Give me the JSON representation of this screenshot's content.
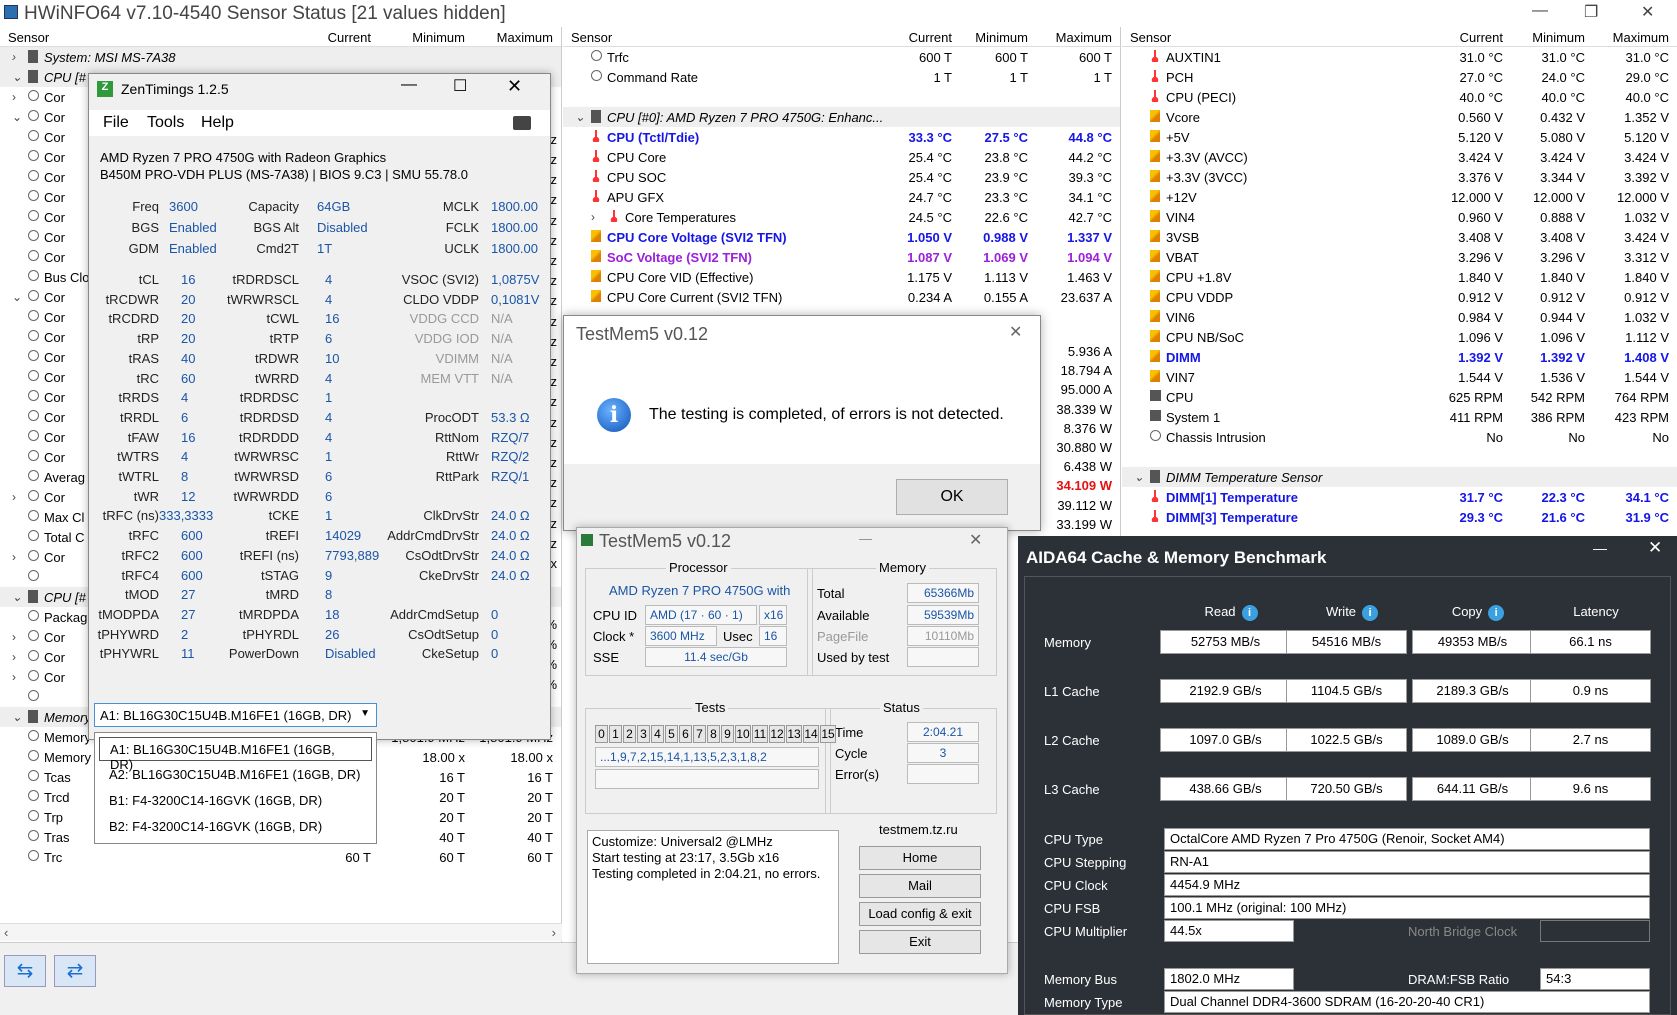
{
  "hwinfo": {
    "title": "HWiNFO64 v7.10-4540 Sensor Status [21 values hidden]",
    "left": {
      "cols": [
        "Sensor",
        "Current",
        "Minimum",
        "Maximum"
      ],
      "rows": [
        {
          "name": "System: MSI MS-7A38",
          "grp": true,
          "exp": ">"
        },
        {
          "name": "CPU [#",
          "grp": true,
          "exp": "v"
        },
        {
          "name": "Cor",
          "exp": ">"
        },
        {
          "name": "Cor",
          "exp": "v"
        },
        {
          "name": "Cor"
        },
        {
          "name": "Cor"
        },
        {
          "name": "Cor"
        },
        {
          "name": "Cor"
        },
        {
          "name": "Cor"
        },
        {
          "name": "Cor"
        },
        {
          "name": "Cor"
        },
        {
          "name": "Bus Clo"
        },
        {
          "name": "Cor",
          "exp": "v"
        },
        {
          "name": "Cor"
        },
        {
          "name": "Cor"
        },
        {
          "name": "Cor"
        },
        {
          "name": "Cor"
        },
        {
          "name": "Cor"
        },
        {
          "name": "Cor"
        },
        {
          "name": "Cor"
        },
        {
          "name": "Cor"
        },
        {
          "name": "Averag"
        },
        {
          "name": "Cor",
          "exp": ">"
        },
        {
          "name": "Max Cl"
        },
        {
          "name": "Total C"
        },
        {
          "name": "Cor",
          "exp": ">"
        },
        {
          "name": ""
        },
        {
          "name": "CPU [#",
          "grp": true,
          "exp": "v"
        },
        {
          "name": "Packag"
        },
        {
          "name": "Cor",
          "exp": ">"
        },
        {
          "name": "Cor",
          "exp": ">"
        },
        {
          "name": "Cor",
          "exp": ">"
        },
        {
          "name": ""
        },
        {
          "name": "Memory",
          "grp": true,
          "exp": "v"
        },
        {
          "name": "Memory",
          "c": "z",
          "mn": "1,801.9 MHz",
          "mx": "1,801.9 MHz"
        },
        {
          "name": "Memory",
          "c": "x",
          "mn": "18.00 x",
          "mx": "18.00 x"
        },
        {
          "name": "Tcas",
          "c": "T",
          "mn": "16 T",
          "mx": "16 T"
        },
        {
          "name": "Trcd",
          "c": "T",
          "mn": "20 T",
          "mx": "20 T"
        },
        {
          "name": "Trp",
          "c": "20 T",
          "mn": "20 T",
          "mx": "20 T"
        },
        {
          "name": "Tras",
          "c": "40 T",
          "mn": "40 T",
          "mx": "40 T"
        },
        {
          "name": "Trc",
          "c": "60 T",
          "mn": "60 T",
          "mx": "60 T"
        }
      ],
      "rightcol": [
        "",
        "",
        "",
        "",
        "Hz",
        "Hz",
        "Hz",
        "Hz",
        "Hz",
        "Hz",
        "Hz",
        "Hz",
        "Hz",
        "Hz",
        "Hz",
        "Hz",
        "Hz",
        "Hz",
        "Hz",
        "Hz",
        "Hz",
        "Hz",
        "Hz",
        "Hz",
        "Hz",
        "x",
        "",
        "",
        "%",
        "%",
        "%",
        "%"
      ]
    },
    "mid": {
      "cols": [
        "Sensor",
        "Current",
        "Minimum",
        "Maximum"
      ],
      "rows": [
        {
          "name": "Trfc",
          "i": "c",
          "c": "600 T",
          "mn": "600 T",
          "mx": "600 T"
        },
        {
          "name": "Command Rate",
          "i": "c",
          "c": "1 T",
          "mn": "1 T",
          "mx": "1 T"
        },
        {
          "name": "",
          "i": "",
          "c": "",
          "mn": "",
          "mx": ""
        },
        {
          "name": "CPU [#0]: AMD Ryzen 7 PRO 4750G: Enhanc...",
          "i": "chip",
          "grp": true,
          "exp": "v"
        },
        {
          "name": "CPU (Tctl/Tdie)",
          "i": "t",
          "c": "33.3 °C",
          "mn": "27.5 °C",
          "mx": "44.8 °C",
          "cl": "blue"
        },
        {
          "name": "CPU Core",
          "i": "t",
          "c": "25.4 °C",
          "mn": "23.8 °C",
          "mx": "44.2 °C"
        },
        {
          "name": "CPU SOC",
          "i": "t",
          "c": "25.4 °C",
          "mn": "23.9 °C",
          "mx": "39.3 °C"
        },
        {
          "name": "APU GFX",
          "i": "t",
          "c": "24.7 °C",
          "mn": "23.3 °C",
          "mx": "34.1 °C"
        },
        {
          "name": "Core Temperatures",
          "i": "t",
          "c": "24.5 °C",
          "mn": "22.6 °C",
          "mx": "42.7 °C",
          "exp": ">",
          "ind": true
        },
        {
          "name": "CPU Core Voltage (SVI2 TFN)",
          "i": "v",
          "c": "1.050 V",
          "mn": "0.988 V",
          "mx": "1.337 V",
          "cl": "blue"
        },
        {
          "name": "SoC Voltage (SVI2 TFN)",
          "i": "v",
          "c": "1.087 V",
          "mn": "1.069 V",
          "mx": "1.094 V",
          "cl": "purple"
        },
        {
          "name": "CPU Core VID (Effective)",
          "i": "v",
          "c": "1.175 V",
          "mn": "1.113 V",
          "mx": "1.463 V"
        },
        {
          "name": "CPU Core Current (SVI2 TFN)",
          "i": "v",
          "c": "0.234 A",
          "mn": "0.155 A",
          "mx": "23.637 A"
        }
      ],
      "peek": [
        {
          "v": "5.936 A"
        },
        {
          "v": "18.794 A"
        },
        {
          "v": "95.000 A"
        },
        {
          "v": "38.339 W"
        },
        {
          "v": "8.376 W"
        },
        {
          "v": "30.880 W"
        },
        {
          "v": "6.438 W"
        },
        {
          "v": "34.109 W",
          "red": true
        },
        {
          "v": "39.112 W"
        },
        {
          "v": "33.199 W"
        },
        {
          "v": "1,800.0 MHz"
        }
      ]
    },
    "right": {
      "cols": [
        "Sensor",
        "Current",
        "Minimum",
        "Maximum"
      ],
      "rows": [
        {
          "name": "AUXTIN1",
          "i": "t",
          "c": "31.0 °C",
          "mn": "31.0 °C",
          "mx": "31.0 °C"
        },
        {
          "name": "PCH",
          "i": "t",
          "c": "27.0 °C",
          "mn": "24.0 °C",
          "mx": "29.0 °C"
        },
        {
          "name": "CPU (PECI)",
          "i": "t",
          "c": "40.0 °C",
          "mn": "40.0 °C",
          "mx": "40.0 °C"
        },
        {
          "name": "Vcore",
          "i": "v",
          "c": "0.560 V",
          "mn": "0.432 V",
          "mx": "1.352 V"
        },
        {
          "name": "+5V",
          "i": "v",
          "c": "5.120 V",
          "mn": "5.080 V",
          "mx": "5.120 V"
        },
        {
          "name": "+3.3V (AVCC)",
          "i": "v",
          "c": "3.424 V",
          "mn": "3.424 V",
          "mx": "3.424 V"
        },
        {
          "name": "+3.3V (3VCC)",
          "i": "v",
          "c": "3.376 V",
          "mn": "3.344 V",
          "mx": "3.392 V"
        },
        {
          "name": "+12V",
          "i": "v",
          "c": "12.000 V",
          "mn": "12.000 V",
          "mx": "12.000 V"
        },
        {
          "name": "VIN4",
          "i": "v",
          "c": "0.960 V",
          "mn": "0.888 V",
          "mx": "1.032 V"
        },
        {
          "name": "3VSB",
          "i": "v",
          "c": "3.408 V",
          "mn": "3.408 V",
          "mx": "3.424 V"
        },
        {
          "name": "VBAT",
          "i": "v",
          "c": "3.296 V",
          "mn": "3.296 V",
          "mx": "3.312 V"
        },
        {
          "name": "CPU +1.8V",
          "i": "v",
          "c": "1.840 V",
          "mn": "1.840 V",
          "mx": "1.840 V"
        },
        {
          "name": "CPU VDDP",
          "i": "v",
          "c": "0.912 V",
          "mn": "0.912 V",
          "mx": "0.912 V"
        },
        {
          "name": "VIN6",
          "i": "v",
          "c": "0.984 V",
          "mn": "0.944 V",
          "mx": "1.032 V"
        },
        {
          "name": "CPU NB/SoC",
          "i": "v",
          "c": "1.096 V",
          "mn": "1.096 V",
          "mx": "1.112 V"
        },
        {
          "name": "DIMM",
          "i": "v",
          "c": "1.392 V",
          "mn": "1.392 V",
          "mx": "1.408 V",
          "cl": "blue"
        },
        {
          "name": "VIN7",
          "i": "v",
          "c": "1.544 V",
          "mn": "1.536 V",
          "mx": "1.544 V"
        },
        {
          "name": "CPU",
          "i": "f",
          "c": "625 RPM",
          "mn": "542 RPM",
          "mx": "764 RPM"
        },
        {
          "name": "System 1",
          "i": "f",
          "c": "411 RPM",
          "mn": "386 RPM",
          "mx": "423 RPM"
        },
        {
          "name": "Chassis Intrusion",
          "i": "c",
          "c": "No",
          "mn": "No",
          "mx": "No"
        },
        {
          "name": "",
          "i": "",
          "c": "",
          "mn": "",
          "mx": ""
        },
        {
          "name": "DIMM Temperature Sensor",
          "i": "chip",
          "grp": true,
          "exp": "v"
        },
        {
          "name": "DIMM[1] Temperature",
          "i": "t",
          "c": "31.7 °C",
          "mn": "22.3 °C",
          "mx": "34.1 °C",
          "cl": "blue"
        },
        {
          "name": "DIMM[3] Temperature",
          "i": "t",
          "c": "29.3 °C",
          "mn": "21.6 °C",
          "mx": "31.9 °C",
          "cl": "blue"
        }
      ]
    }
  },
  "zen": {
    "title": "ZenTimings 1.2.5",
    "menu": [
      "File",
      "Tools",
      "Help"
    ],
    "cpu": "AMD Ryzen 7 PRO 4750G with Radeon Graphics",
    "board": "B450M PRO-VDH PLUS (MS-7A38) | BIOS 9.C3 | SMU 55.78.0",
    "top": [
      [
        "Freq",
        "3600",
        "Capacity",
        "64GB",
        "MCLK",
        "1800.00"
      ],
      [
        "BGS",
        "Enabled",
        "BGS Alt",
        "Disabled",
        "FCLK",
        "1800.00"
      ],
      [
        "GDM",
        "Enabled",
        "Cmd2T",
        "1T",
        "UCLK",
        "1800.00"
      ]
    ],
    "grid": [
      [
        "tCL",
        "16",
        "tRDRDSCL",
        "4",
        "VSOC (SVI2)",
        "1,0875V"
      ],
      [
        "tRCDWR",
        "20",
        "tWRWRSCL",
        "4",
        "CLDO VDDP",
        "0,1081V"
      ],
      [
        "tRCDRD",
        "20",
        "tCWL",
        "16",
        "VDDG CCD",
        "N/A"
      ],
      [
        "tRP",
        "20",
        "tRTP",
        "6",
        "VDDG IOD",
        "N/A"
      ],
      [
        "tRAS",
        "40",
        "tRDWR",
        "10",
        "VDIMM",
        "N/A"
      ],
      [
        "tRC",
        "60",
        "tWRRD",
        "4",
        "MEM VTT",
        "N/A"
      ],
      [
        "tRRDS",
        "4",
        "tRDRDSC",
        "1",
        "",
        ""
      ],
      [
        "tRRDL",
        "6",
        "tRDRDSD",
        "4",
        "ProcODT",
        "53.3 Ω"
      ],
      [
        "tFAW",
        "16",
        "tRDRDDD",
        "4",
        "RttNom",
        "RZQ/7"
      ],
      [
        "tWTRS",
        "4",
        "tWRWRSC",
        "1",
        "RttWr",
        "RZQ/2"
      ],
      [
        "tWTRL",
        "8",
        "tWRWRSD",
        "6",
        "RttPark",
        "RZQ/1"
      ],
      [
        "tWR",
        "12",
        "tWRWRDD",
        "6",
        "",
        ""
      ],
      [
        "tRFC (ns)",
        "333,3333",
        "tCKE",
        "1",
        "ClkDrvStr",
        "24.0 Ω"
      ],
      [
        "tRFC",
        "600",
        "tREFI",
        "14029",
        "AddrCmdDrvStr",
        "24.0 Ω"
      ],
      [
        "tRFC2",
        "600",
        "tREFI (ns)",
        "7793,889",
        "CsOdtDrvStr",
        "24.0 Ω"
      ],
      [
        "tRFC4",
        "600",
        "tSTAG",
        "9",
        "CkeDrvStr",
        "24.0 Ω"
      ],
      [
        "tMOD",
        "27",
        "tMRD",
        "8",
        "",
        ""
      ],
      [
        "tMODPDA",
        "27",
        "tMRDPDA",
        "18",
        "AddrCmdSetup",
        "0"
      ],
      [
        "tPHYWRD",
        "2",
        "tPHYRDL",
        "26",
        "CsOdtSetup",
        "0"
      ],
      [
        "tPHYWRL",
        "11",
        "PowerDown",
        "Disabled",
        "CkeSetup",
        "0"
      ]
    ],
    "selected": "A1: BL16G30C15U4B.M16FE1 (16GB, DR)",
    "options": [
      "A1: BL16G30C15U4B.M16FE1 (16GB, DR)",
      "A2: BL16G30C15U4B.M16FE1 (16GB, DR)",
      "B1: F4-3200C14-16GVK (16GB, DR)",
      "B2: F4-3200C14-16GVK (16GB, DR)"
    ]
  },
  "tm_dialog": {
    "title": "TestMem5 v0.12",
    "msg": "The testing is completed, of errors is not detected.",
    "ok": "OK"
  },
  "tm": {
    "title": "TestMem5 v0.12",
    "proc_lbl": "Processor",
    "proc": "AMD Ryzen 7 PRO 4750G with",
    "cpuid_lbl": "CPU ID",
    "cpuid": "AMD  (17 · 60 · 1)",
    "x16": "x16",
    "clock_lbl": "Clock *",
    "clock": "3600 MHz",
    "usec_lbl": "Usec",
    "usec": "16",
    "sse_lbl": "SSE",
    "sse": "11.4 sec/Gb",
    "mem_lbl": "Memory",
    "total_lbl": "Total",
    "total": "65366Mb",
    "avail_lbl": "Available",
    "avail": "59539Mb",
    "pf_lbl": "PageFile",
    "pf": "10110Mb",
    "used_lbl": "Used by test",
    "used": "",
    "tests_lbl": "Tests",
    "tests": [
      "0",
      "1",
      "2",
      "3",
      "4",
      "5",
      "6",
      "7",
      "8",
      "9",
      "10",
      "11",
      "12",
      "13",
      "14",
      "15"
    ],
    "seq": "...1,9,7,2,15,14,1,13,5,2,3,1,8,2",
    "status_lbl": "Status",
    "time_lbl": "Time",
    "time": "2:04.21",
    "cycle_lbl": "Cycle",
    "cycle": "3",
    "err_lbl": "Error(s)",
    "err": "",
    "log": [
      "Customize: Universal2 @LMHz",
      "Start testing at 23:17, 3.5Gb x16",
      "Testing completed in 2:04.21, no errors."
    ],
    "site": "testmem.tz.ru",
    "btns": [
      "Home",
      "Mail",
      "Load config & exit",
      "Exit"
    ]
  },
  "aida": {
    "title": "AIDA64 Cache & Memory Benchmark",
    "cols": [
      "Read",
      "Write",
      "Copy",
      "Latency"
    ],
    "rows": [
      [
        "Memory",
        "52753 MB/s",
        "54516 MB/s",
        "49353 MB/s",
        "66.1 ns"
      ],
      [
        "L1 Cache",
        "2192.9 GB/s",
        "1104.5 GB/s",
        "2189.3 GB/s",
        "0.9 ns"
      ],
      [
        "L2 Cache",
        "1097.0 GB/s",
        "1022.5 GB/s",
        "1089.0 GB/s",
        "2.7 ns"
      ],
      [
        "L3 Cache",
        "438.66 GB/s",
        "720.50 GB/s",
        "644.11 GB/s",
        "9.6 ns"
      ]
    ],
    "cputype_lbl": "CPU Type",
    "cputype": "OctalCore AMD Ryzen 7 Pro 4750G  (Renoir, Socket AM4)",
    "step_lbl": "CPU Stepping",
    "step": "RN-A1",
    "clk_lbl": "CPU Clock",
    "clk": "4454.9 MHz",
    "fsb_lbl": "CPU FSB",
    "fsb": "100.1 MHz  (original: 100 MHz)",
    "mult_lbl": "CPU Multiplier",
    "mult": "44.5x",
    "nb_lbl": "North Bridge Clock",
    "nb": "",
    "bus_lbl": "Memory Bus",
    "bus": "1802.0 MHz",
    "ratio_lbl": "DRAM:FSB Ratio",
    "ratio": "54:3",
    "mtype_lbl": "Memory Type",
    "mtype": "Dual Channel DDR4-3600 SDRAM  (16-20-20-40 CR1)"
  },
  "colors": {
    "blue": "#1515e6",
    "purple": "#9b20d9",
    "red": "#e41111",
    "aida_bg": "#2c3137"
  }
}
